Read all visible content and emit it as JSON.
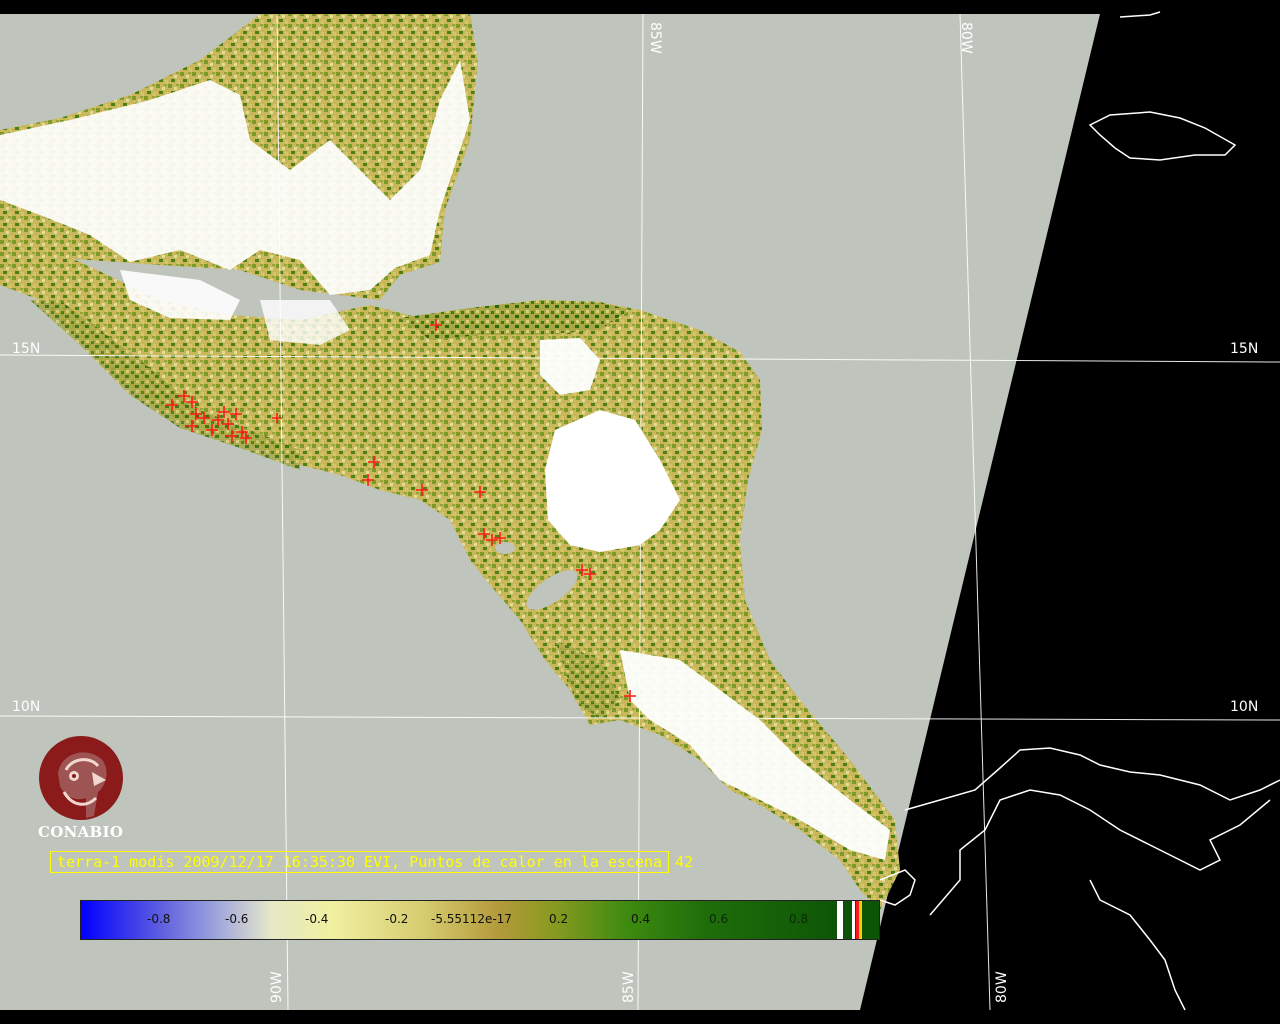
{
  "map": {
    "grid_labels": {
      "lon_85w_top": "85W",
      "lon_80w_top": "80W",
      "lat_15n_left": "15N",
      "lat_15n_right": "15N",
      "lat_10n_left": "10N",
      "lat_10n_right": "10N",
      "lon_90w_bottom": "90W",
      "lon_85w_bottom": "85W",
      "lon_80w_bottom": "80W"
    },
    "colors": {
      "no_data": "#bfc4bc",
      "night": "#000000",
      "cloud": "#ffffff",
      "fire": "#ff1a1a",
      "grid": "#ffffff",
      "coastline": "#ffffff"
    }
  },
  "logo": {
    "icon": "conabio-macaw-logo-icon",
    "text": "CONABIO"
  },
  "caption": {
    "text": "terra-1 modis 2009/12/17 16:35:30 EVI, Puntos de calor en la escena",
    "count": "42"
  },
  "colorbar": {
    "ticks": [
      "-0.8",
      "-0.6",
      "-0.4",
      "-0.2",
      "-5.55112e-17",
      "0.2",
      "0.4",
      "0.6",
      "0.8"
    ]
  }
}
